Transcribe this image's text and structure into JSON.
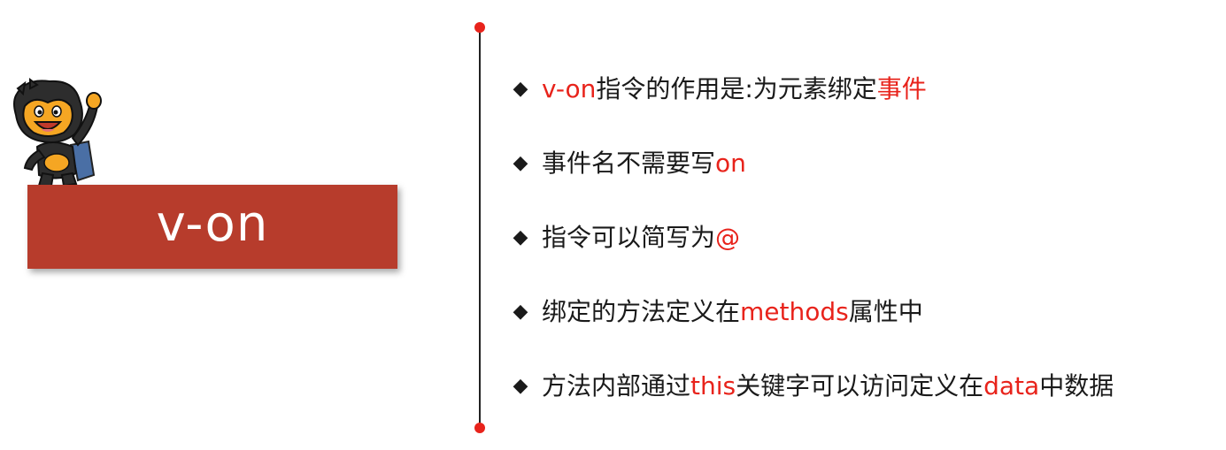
{
  "slide": {
    "title": "v-on",
    "mascot_icon": "monkey-mascot-icon",
    "colors": {
      "banner": "#b73c2c",
      "highlight": "#e8231b",
      "text": "#1a1a1a"
    }
  },
  "bullets": [
    {
      "marker": "◆",
      "segments": [
        {
          "text": "v-on",
          "hl": true
        },
        {
          "text": "指令的作用是:为元素绑定",
          "hl": false
        },
        {
          "text": "事件",
          "hl": true
        }
      ]
    },
    {
      "marker": "◆",
      "segments": [
        {
          "text": "事件名不需要写",
          "hl": false
        },
        {
          "text": "on",
          "hl": true
        }
      ]
    },
    {
      "marker": "◆",
      "segments": [
        {
          "text": "指令可以简写为",
          "hl": false
        },
        {
          "text": "@",
          "hl": true
        }
      ]
    },
    {
      "marker": "◆",
      "segments": [
        {
          "text": "绑定的方法定义在",
          "hl": false
        },
        {
          "text": "methods",
          "hl": true
        },
        {
          "text": "属性中",
          "hl": false
        }
      ]
    },
    {
      "marker": "◆",
      "segments": [
        {
          "text": "方法内部通过",
          "hl": false
        },
        {
          "text": "this",
          "hl": true
        },
        {
          "text": "关键字可以访问定义在",
          "hl": false
        },
        {
          "text": "data",
          "hl": true
        },
        {
          "text": "中数据",
          "hl": false
        }
      ]
    }
  ]
}
